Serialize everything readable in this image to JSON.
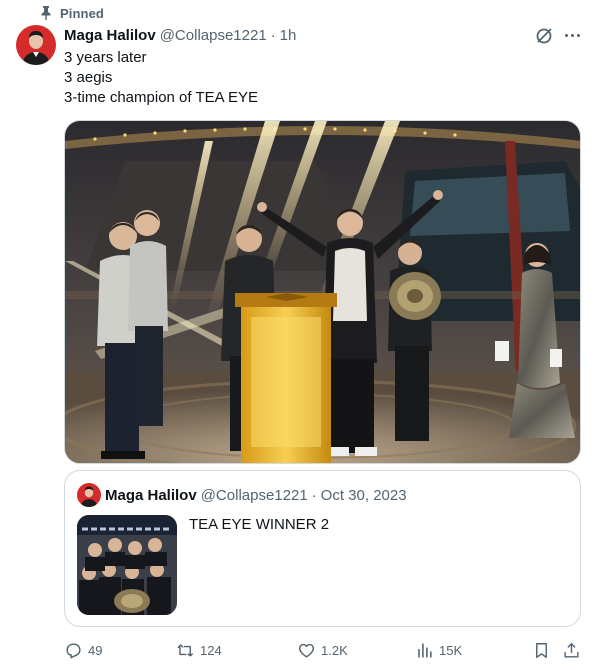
{
  "pinned": {
    "label": "Pinned",
    "icon": "pin-icon"
  },
  "author": {
    "name": "Maga Halilov",
    "handle": "@Collapse1221",
    "separator": "·",
    "time": "1h"
  },
  "tweet": {
    "lines": [
      "3 years later",
      "3 aegis",
      "3-time champion of TEA EYE"
    ]
  },
  "quoted": {
    "author": {
      "name": "Maga Halilov",
      "handle": "@Collapse1221",
      "separator": "·",
      "date": "Oct 30, 2023"
    },
    "text": "TEA EYE WINNER 2"
  },
  "actions": {
    "replies": "49",
    "reposts": "124",
    "likes": "1.2K",
    "views": "15K"
  },
  "colors": {
    "text": "#0f1419",
    "secondary": "#536471",
    "border": "#cfd9de",
    "avatar_bg": "#d52b2b"
  }
}
